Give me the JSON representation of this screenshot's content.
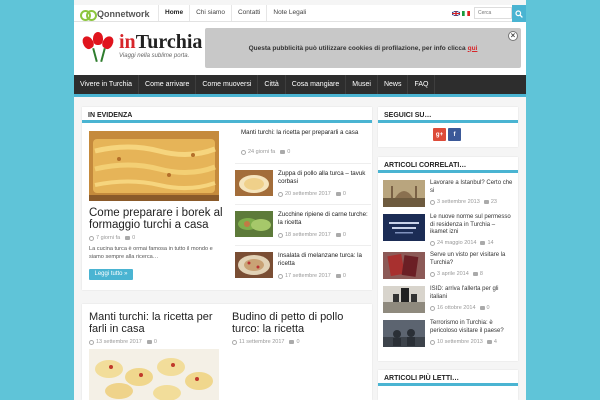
{
  "topbar": {
    "brand": "Qonnetwork",
    "nav": [
      "Home",
      "Chi siamo",
      "Contatti",
      "Note Legali"
    ],
    "search_placeholder": "Cerca"
  },
  "header": {
    "logo_prefix": "in",
    "logo_name": "Turchia",
    "tagline": "Viaggi nella sublime porta.",
    "cookie_text": "Questa pubblicità può utilizzare cookies di profilazione, per info clicca",
    "cookie_link": "qui",
    "close": "×"
  },
  "mainnav": [
    "Vivere in Turchia",
    "Come arrivare",
    "Come muoversi",
    "Città",
    "Cosa mangiare",
    "Musei",
    "News",
    "FAQ"
  ],
  "evidenza": {
    "heading": "In evidenza",
    "featured": {
      "title": "Come preparare i borek al formaggio turchi a casa",
      "date": "7 giorni fa",
      "comments": "0",
      "excerpt": "La cucina turca è ormai famosa in tutto il mondo e siamo sempre alla ricerca…",
      "more": "Leggi tutto »"
    },
    "items": [
      {
        "title": "Manti turchi: la ricetta per prepararli a casa",
        "date": "24 giorni fa",
        "comments": "0"
      },
      {
        "title": "Zuppa di pollo alla turca – tavuk corbasi",
        "date": "20 settembre 2017",
        "comments": "0"
      },
      {
        "title": "Zucchine ripiene di carne turche: la ricetta",
        "date": "18 settembre 2017",
        "comments": "0"
      },
      {
        "title": "Insalata di melanzane turca: la ricetta",
        "date": "17 settembre 2017",
        "comments": "0"
      }
    ]
  },
  "posts": [
    {
      "title": "Manti turchi: la ricetta per farli in casa",
      "date": "13 settembre 2017",
      "comments": "0"
    },
    {
      "title": "Budino di petto di pollo turco: la ricetta",
      "date": "11 settembre 2017",
      "comments": "0"
    }
  ],
  "sidebar": {
    "follow_heading": "Seguici su…",
    "gplus": "g+",
    "facebook": "f",
    "related_heading": "Articoli correlati…",
    "related": [
      {
        "title": "Lavorare a Istanbul? Certo che si",
        "date": "3 settembre 2013",
        "comments": "23"
      },
      {
        "title": "Le nuove norme sul permesso di residenza in Turchia – ikamet izni",
        "date": "24 maggio 2014",
        "comments": "14"
      },
      {
        "title": "Serve un visto per visitare la Turchia?",
        "date": "3 aprile 2014",
        "comments": "8"
      },
      {
        "title": "ISID: arriva l'allerta per gli italiani",
        "date": "16 ottobre 2014",
        "comments": "0"
      },
      {
        "title": "Terrorismo in Turchia: è pericoloso visitare il paese?",
        "date": "10 settembre 2013",
        "comments": "4"
      }
    ],
    "popular_heading": "Articoli più letti…"
  },
  "colors": {
    "accent": "#4ab4d2",
    "nav_bg": "#2d2d2d",
    "page_bg": "#5fc4d8",
    "brand_red": "#d7262b"
  }
}
